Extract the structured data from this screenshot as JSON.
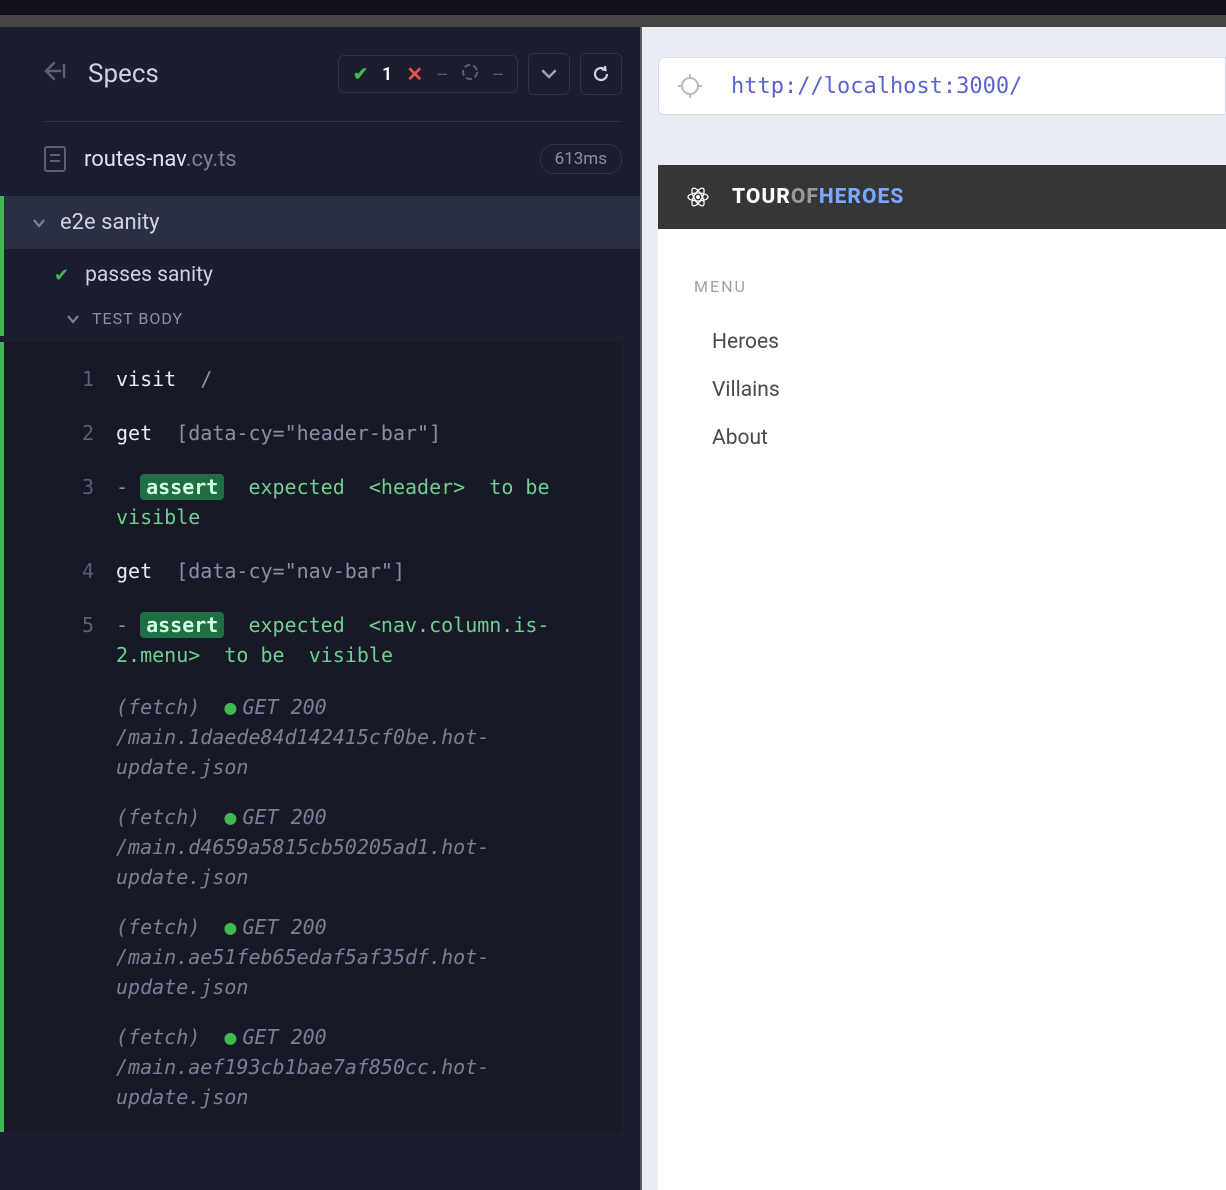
{
  "header": {
    "title": "Specs",
    "pass_count": "1",
    "fail_count": "--",
    "pending_count": "--"
  },
  "spec": {
    "name": "routes-nav",
    "ext": ".cy.ts",
    "duration": "613ms",
    "suite": "e2e sanity",
    "test": "passes sanity",
    "body_label": "TEST BODY"
  },
  "log": [
    {
      "n": "1",
      "cmd": "visit",
      "arg": "/"
    },
    {
      "n": "2",
      "cmd": "get",
      "arg": "[data-cy=\"header-bar\"]"
    },
    {
      "n": "3",
      "assert": true,
      "expected": "expected",
      "sel": "<header>",
      "tail": "to be visible"
    },
    {
      "n": "4",
      "cmd": "get",
      "arg": "[data-cy=\"nav-bar\"]"
    },
    {
      "n": "5",
      "assert": true,
      "expected": "expected",
      "sel": "<nav.column.is-2.menu>",
      "tail": "to be",
      "tail2": "visible"
    }
  ],
  "fetches": [
    {
      "label": "(fetch)",
      "status": "GET 200",
      "path": "/main.1daede84d142415cf0be.hot-update.json"
    },
    {
      "label": "(fetch)",
      "status": "GET 200",
      "path": "/main.d4659a5815cb50205ad1.hot-update.json"
    },
    {
      "label": "(fetch)",
      "status": "GET 200",
      "path": "/main.ae51feb65edaf5af35df.hot-update.json"
    },
    {
      "label": "(fetch)",
      "status": "GET 200",
      "path": "/main.aef193cb1bae7af850cc.hot-update.json"
    }
  ],
  "preview": {
    "url": "http://localhost:3000/",
    "brand1": "TOUR",
    "brand2": "OF",
    "brand3": "HEROES",
    "menu_label": "MENU",
    "items": [
      "Heroes",
      "Villains",
      "About"
    ]
  }
}
